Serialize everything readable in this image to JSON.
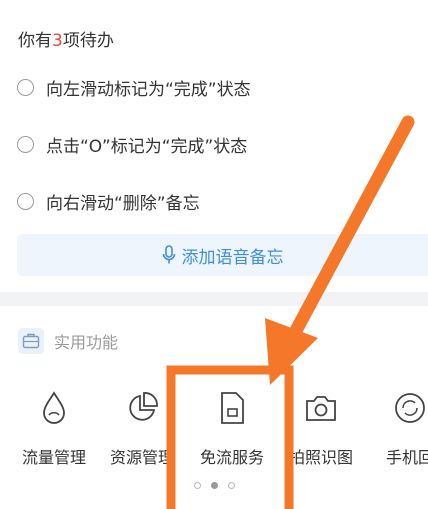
{
  "todo": {
    "prefix": "你有",
    "count": "3",
    "suffix": "项待办",
    "items": [
      {
        "label": "向左滑动标记为“完成”状态"
      },
      {
        "label": "点击“O”标记为“完成”状态"
      },
      {
        "label": "向右滑动“删除”备忘"
      }
    ],
    "voice_button_label": "添加语音备忘"
  },
  "features": {
    "title": "实用功能",
    "tools": [
      {
        "label": "流量管理",
        "icon": "water-drop-icon"
      },
      {
        "label": "资源管理",
        "icon": "pie-chart-icon"
      },
      {
        "label": "免流服务",
        "icon": "sim-card-icon"
      },
      {
        "label": "拍照识图",
        "icon": "camera-icon"
      },
      {
        "label": "手机回",
        "icon": "recycle-icon"
      }
    ],
    "pages": 3,
    "active_page": 2
  },
  "colors": {
    "accent": "#3f8ee0",
    "count_red": "#e8483c",
    "annotation_orange": "#f5772a"
  }
}
